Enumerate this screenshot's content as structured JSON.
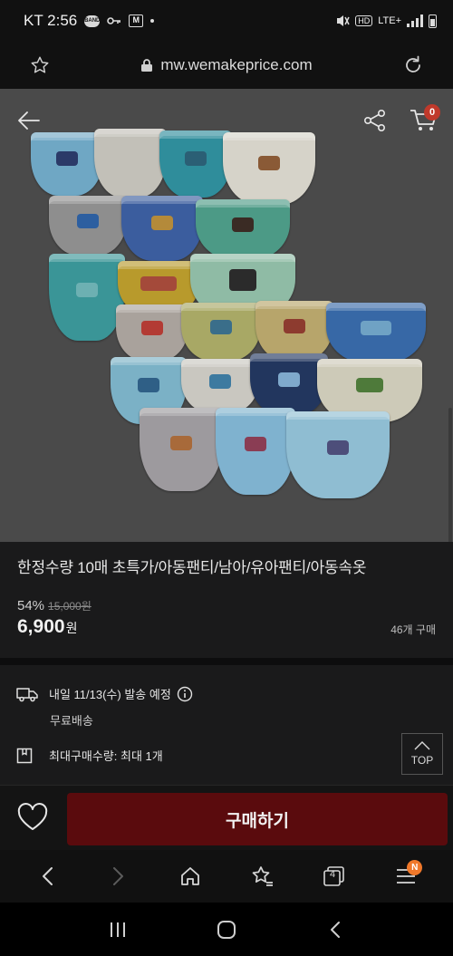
{
  "status_bar": {
    "carrier_time": "KT 2:56",
    "app_icons": [
      "band-icon",
      "key-icon",
      "mail-icon"
    ],
    "hd": "HD",
    "network": "LTE+"
  },
  "browser": {
    "url": "mw.wemakeprice.com"
  },
  "product": {
    "cart_count": "0",
    "title": "한정수량 10매 초특가/아동팬티/남아/유아팬티/아동속옷",
    "discount": "54%",
    "original_price": "15,000원",
    "price": "6,900",
    "price_unit": "원",
    "sold": "46개 구매"
  },
  "delivery": {
    "ship_date": "내일 11/13(수) 발송 예정",
    "free_shipping": "무료배송",
    "max_qty": "최대구매수량: 최대 1개"
  },
  "top_button": "TOP",
  "buy_label": "구매하기",
  "toolbar": {
    "tabs_count": "4",
    "menu_badge": "N"
  },
  "colors": {
    "buy_button": "#5a0b0d",
    "cart_badge": "#c0392b",
    "menu_badge": "#f0782a"
  }
}
